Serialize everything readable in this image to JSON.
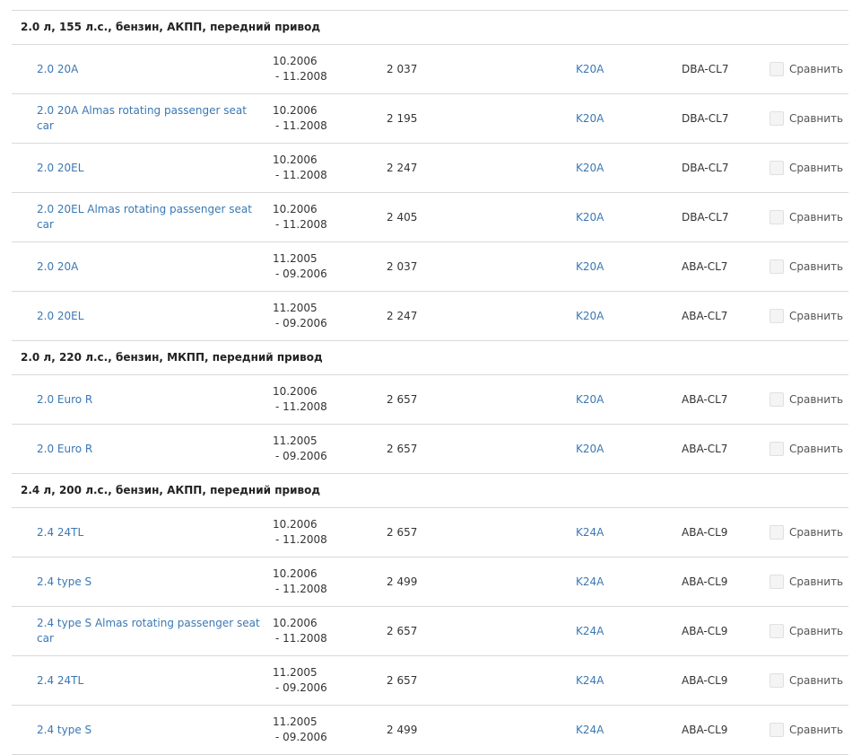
{
  "groups": [
    {
      "title": "2.0 л, 155 л.с., бензин, АКПП, передний привод",
      "rows": [
        {
          "name": "2.0 20A",
          "from": "10.2006",
          "to": "- 11.2008",
          "price": "2 037",
          "engine": "K20A",
          "body": "DBA-CL7",
          "compare": "Сравнить"
        },
        {
          "name": "2.0 20A Almas rotating passenger seat car",
          "from": "10.2006",
          "to": "- 11.2008",
          "price": "2 195",
          "engine": "K20A",
          "body": "DBA-CL7",
          "compare": "Сравнить"
        },
        {
          "name": "2.0 20EL",
          "from": "10.2006",
          "to": "- 11.2008",
          "price": "2 247",
          "engine": "K20A",
          "body": "DBA-CL7",
          "compare": "Сравнить"
        },
        {
          "name": "2.0 20EL Almas rotating passenger seat car",
          "from": "10.2006",
          "to": "- 11.2008",
          "price": "2 405",
          "engine": "K20A",
          "body": "DBA-CL7",
          "compare": "Сравнить"
        },
        {
          "name": "2.0 20A",
          "from": "11.2005",
          "to": "- 09.2006",
          "price": "2 037",
          "engine": "K20A",
          "body": "ABA-CL7",
          "compare": "Сравнить"
        },
        {
          "name": "2.0 20EL",
          "from": "11.2005",
          "to": "- 09.2006",
          "price": "2 247",
          "engine": "K20A",
          "body": "ABA-CL7",
          "compare": "Сравнить"
        }
      ]
    },
    {
      "title": "2.0 л, 220 л.с., бензин, МКПП, передний привод",
      "rows": [
        {
          "name": "2.0 Euro R",
          "from": "10.2006",
          "to": "- 11.2008",
          "price": "2 657",
          "engine": "K20A",
          "body": "ABA-CL7",
          "compare": "Сравнить"
        },
        {
          "name": "2.0 Euro R",
          "from": "11.2005",
          "to": "- 09.2006",
          "price": "2 657",
          "engine": "K20A",
          "body": "ABA-CL7",
          "compare": "Сравнить"
        }
      ]
    },
    {
      "title": "2.4 л, 200 л.с., бензин, АКПП, передний привод",
      "rows": [
        {
          "name": "2.4 24TL",
          "from": "10.2006",
          "to": "- 11.2008",
          "price": "2 657",
          "engine": "K24A",
          "body": "ABA-CL9",
          "compare": "Сравнить"
        },
        {
          "name": "2.4 type S",
          "from": "10.2006",
          "to": "- 11.2008",
          "price": "2 499",
          "engine": "K24A",
          "body": "ABA-CL9",
          "compare": "Сравнить"
        },
        {
          "name": "2.4 type S Almas rotating passenger seat car",
          "from": "10.2006",
          "to": "- 11.2008",
          "price": "2 657",
          "engine": "K24A",
          "body": "ABA-CL9",
          "compare": "Сравнить"
        },
        {
          "name": "2.4 24TL",
          "from": "11.2005",
          "to": "- 09.2006",
          "price": "2 657",
          "engine": "K24A",
          "body": "ABA-CL9",
          "compare": "Сравнить"
        },
        {
          "name": "2.4 type S",
          "from": "11.2005",
          "to": "- 09.2006",
          "price": "2 499",
          "engine": "K24A",
          "body": "ABA-CL9",
          "compare": "Сравнить"
        }
      ]
    }
  ]
}
